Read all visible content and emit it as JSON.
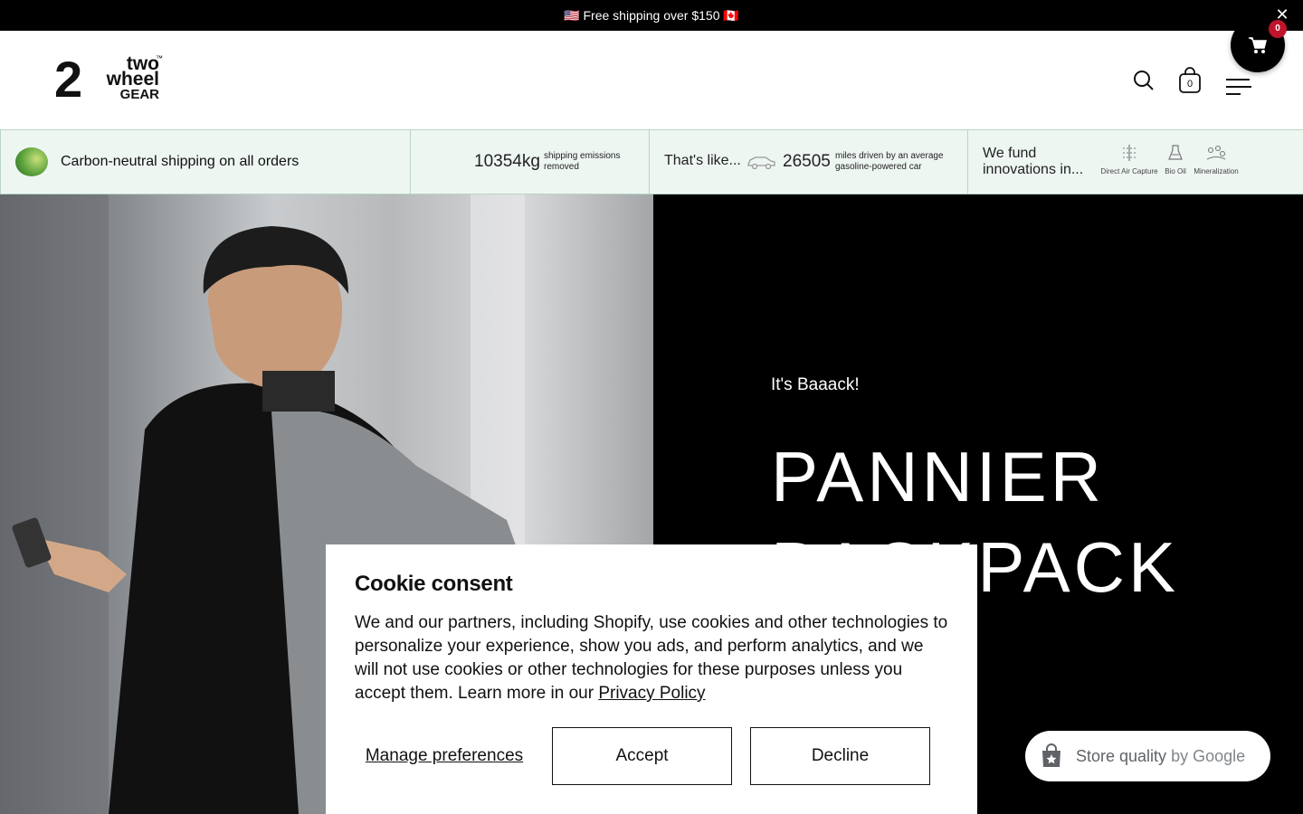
{
  "announcement": {
    "text": "🇺🇸 Free shipping over $150 🇨🇦"
  },
  "header": {
    "logo_num": "2",
    "logo_line1": "two",
    "logo_line2": "wheel",
    "logo_line3": "GEAR",
    "logo_tm": "™",
    "cart_count": "0",
    "floating_cart_count": "0"
  },
  "eco": {
    "shipping": "Carbon-neutral shipping on all orders",
    "emissions_value": "10354kg",
    "emissions_label": "shipping emissions removed",
    "thats_like": "That's like...",
    "miles_value": "26505",
    "miles_label": "miles driven by an average gasoline-powered car",
    "fund_label": "We fund innovations in...",
    "innovations": [
      "Direct Air Capture",
      "Bio Oil",
      "Mineralization"
    ]
  },
  "hero": {
    "kicker": "It's Baaack!",
    "title_line1": "PANNIER",
    "title_line2": "BACKPACK"
  },
  "cookie": {
    "title": "Cookie consent",
    "body": "We and our partners, including Shopify, use cookies and other technologies to personalize your experience, show you ads, and perform analytics, and we will not use cookies or other technologies for these purposes unless you accept them. Learn more in our ",
    "policy_link": "Privacy Policy",
    "manage": "Manage preferences",
    "accept": "Accept",
    "decline": "Decline"
  },
  "google_badge": {
    "label": "Store quality",
    "by": " by Google"
  }
}
